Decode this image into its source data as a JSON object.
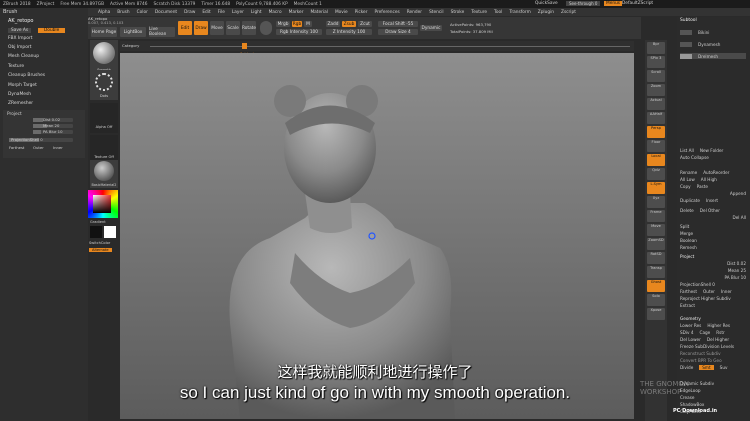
{
  "titlebar": {
    "app": "ZBrush 2018",
    "items": [
      "ZProject",
      "Free Mem 34.897GB",
      "Active Mem 8746",
      "Scratch Disk 13379",
      "Timer 16.648",
      "PolyCount 9,788.406 KP",
      "MeshCount 1"
    ],
    "quicksave": "QuickSave",
    "seethrough": "See-through 0",
    "menus_btn": "Menus",
    "script": "DefaultZScript"
  },
  "menubar": [
    "Alpha",
    "Brush",
    "Color",
    "Document",
    "Draw",
    "Edit",
    "File",
    "Layer",
    "Light",
    "Macro",
    "Marker",
    "Material",
    "Movie",
    "Picker",
    "Preferences",
    "Render",
    "Stencil",
    "Stroke",
    "Texture",
    "Tool",
    "Transform",
    "Zplugin",
    "Zscript"
  ],
  "coords": "0.007, 0.413, 0.103",
  "toolbar": {
    "home": "Home Page",
    "lightbox": "LightBox",
    "liveboolean": "Live Boolean",
    "edit": "Edit",
    "draw": "Draw",
    "move": "Move",
    "scale": "Scale",
    "rotate": "Rotate",
    "mrgb": "Mrgb",
    "rgb": "Rgb",
    "m": "M",
    "rgb_intensity": "Rgb Intensity 100",
    "zadd": "Zadd",
    "zsub": "Zsub",
    "zcut": "Zcut",
    "z_intensity": "Z Intensity 100",
    "focal_shift": "Focal Shift -55",
    "draw_size": "Draw Size 4",
    "dynamic": "Dynamic",
    "active_points": "ActivePoints: 963,790",
    "total_points": "TotalPoints: 37.809 Mil",
    "category": "Category"
  },
  "timeline_label": "Subtool",
  "leftpanel": {
    "brush_label": "Brush",
    "tool_name": "AK_retopo",
    "save_as": "Save As",
    "double": "Double",
    "menu": [
      "FBX Import",
      "Obj Import",
      "Mesh Cleanup",
      "Texture",
      "Cleanup Brushes",
      "Morph Target",
      "DynaMesh",
      "ZRemesher",
      "Project"
    ],
    "dist": "Dist 0.02",
    "mean": "Mean 20",
    "pa_blur": "PA Blur 10",
    "projection_shell": "ProjectionShell 0",
    "farthest": "Farthest",
    "outer": "Outer",
    "inner": "Inner"
  },
  "tray": {
    "brush_name": "Smooth",
    "stroke": "Dots",
    "alpha": "Alpha Off",
    "texture": "Texture Off",
    "material": "BasicMaterial2",
    "gradient": "Gradient",
    "switchcolor": "SwitchColor",
    "alternate": "Alternate"
  },
  "rightpanel": {
    "subtool_header": "Subtool",
    "subtools": [
      "Bikini",
      "Dynamesh",
      "Drelmesh"
    ],
    "list_all": "List All",
    "new_folder": "New Folder",
    "auto_collapse": "Auto Collapse",
    "rename": "Rename",
    "autoreorder": "AutoReorder",
    "all_low": "All Low",
    "all_high": "All High",
    "copy": "Copy",
    "paste": "Paste",
    "append": "Append",
    "duplicate": "Duplicate",
    "insert": "Insert",
    "delete": "Delete",
    "del_other": "Del Other",
    "del_all": "Del All",
    "split": "Split",
    "merge": "Merge",
    "boolean": "Boolean",
    "remesh": "Remesh",
    "project": "Project",
    "dist": "Dist 0.02",
    "mean": "Mean 25",
    "pa_blur": "PA Blur 10",
    "projection_shell": "ProjectionShell 0",
    "farthest": "Farthest",
    "outer": "Outer",
    "inner": "Inner",
    "reproject": "Reproject Higher Subdiv",
    "extract": "Extract",
    "geometry": "Geometry",
    "lower_res": "Lower Res",
    "higher_res": "Higher Res",
    "sdiv": "SDiv 4",
    "cage": "Cage",
    "rstr": "Rstr",
    "del_lower": "Del Lower",
    "del_higher": "Del Higher",
    "freeze": "Freeze SubDivision Levels",
    "reconstruct": "Reconstruct Subdiv",
    "convert": "Convert BPR To Geo",
    "divide": "Divide",
    "smt": "Smt",
    "suv": "Suv",
    "dynamic_subdiv": "Dynamic Subdiv",
    "edgeloop": "EdgeLoop",
    "crease": "Crease",
    "shadowbox": "ShadowBox",
    "claypolish": "ClayPolish"
  },
  "shelf": [
    "Bpr",
    "SPix 3",
    "Scroll",
    "Zoom",
    "Actual",
    "AAHalf",
    "Persp",
    "Floor",
    "Local",
    "Qviz",
    "L.Sym",
    "Xyz",
    "Frame",
    "Move",
    "ZoomSD",
    "RotSD",
    "Transp",
    "Ghost",
    "Solo",
    "Xpose"
  ],
  "subtitles": {
    "cn": "这样我就能顺利地进行操作了",
    "en": "so I can just kind of go in with my smooth operation."
  },
  "watermark": {
    "line1": "THE GNOMON",
    "line2": "WORKSHOP",
    "site": "PC Download.in"
  },
  "colors": {
    "accent": "#e8871e",
    "panel": "#2e2e2e",
    "canvas_top": "#8e8e8e",
    "canvas_bottom": "#5c5c5c"
  }
}
